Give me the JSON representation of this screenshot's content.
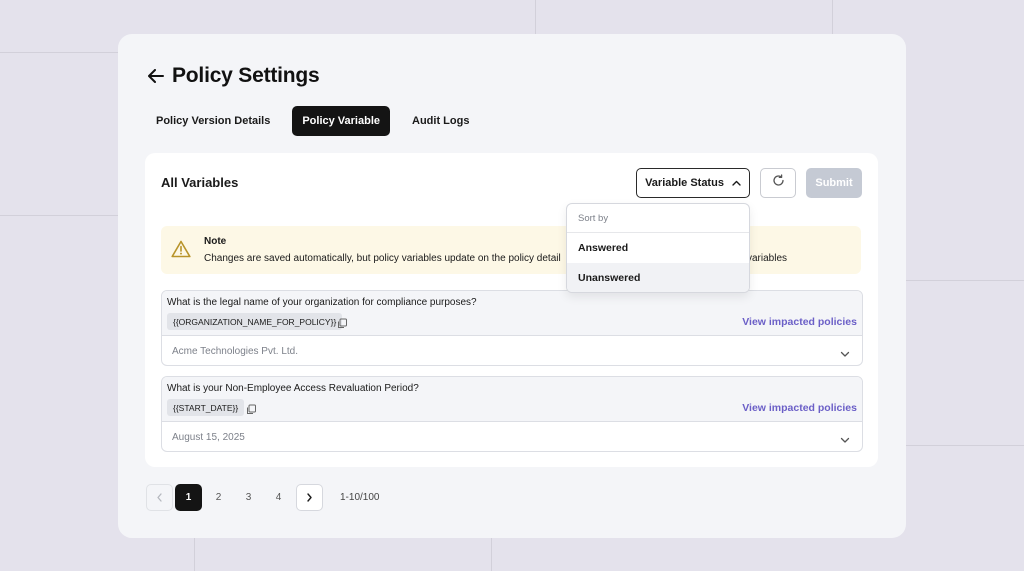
{
  "page": {
    "title": "Policy Settings"
  },
  "tabs": [
    {
      "label": "Policy Version Details",
      "active": false
    },
    {
      "label": "Policy Variable",
      "active": true
    },
    {
      "label": "Audit Logs",
      "active": false
    }
  ],
  "panel": {
    "title": "All Variables",
    "status_button": "Variable Status",
    "submit_button": "Submit"
  },
  "dropdown": {
    "label": "Sort by",
    "options": [
      "Answered",
      "Unanswered"
    ]
  },
  "note": {
    "title": "Note",
    "text": "Changes are saved automatically, but policy variables update on the policy detail",
    "text_end": "variables"
  },
  "variables": [
    {
      "question": "What is the legal name of your organization for compliance purposes?",
      "tag": "{{ORGANIZATION_NAME_FOR_POLICY}}",
      "link": "View impacted policies",
      "answer": "Acme Technologies Pvt. Ltd."
    },
    {
      "question": "What is your Non-Employee Access Revaluation Period?",
      "tag": "{{START_DATE}}",
      "link": "View impacted policies",
      "answer": "August 15, 2025"
    }
  ],
  "pagination": {
    "pages": [
      "1",
      "2",
      "3",
      "4"
    ],
    "current": "1",
    "range": "1-10/100"
  },
  "colors": {
    "accent": "#6b5fc7",
    "active_tab": "#141414",
    "note_bg": "#fdf8e6",
    "warning": "#c9a227"
  },
  "icons": {
    "back": "arrow-left-icon",
    "chevron": "chevron-up-icon",
    "refresh": "refresh-icon",
    "warning": "warning-triangle-icon",
    "copy": "copy-icon",
    "expand": "chevron-down-icon"
  }
}
